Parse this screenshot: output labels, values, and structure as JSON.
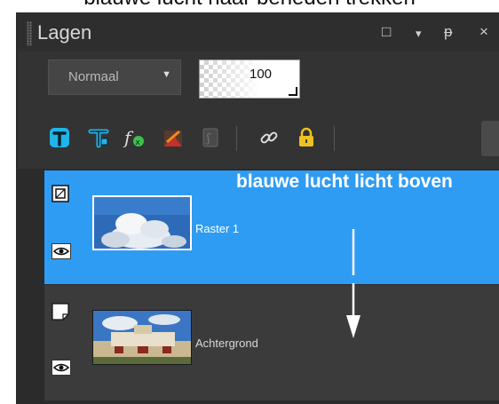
{
  "caption_top": "blauwe lucht naar beneden trekken",
  "panel": {
    "title": "Lagen",
    "controls": {
      "restore": "□",
      "menu": "▾",
      "pin": "ᵽ",
      "close": "×"
    }
  },
  "blend": {
    "mode": "Normaal"
  },
  "opacity": {
    "value": "100"
  },
  "toolbar": {
    "icons": [
      "new-raster-layer-icon",
      "new-vector-layer-icon",
      "layer-effects-icon",
      "layer-style-icon",
      "mask-icon",
      "link-icon",
      "lock-icon"
    ]
  },
  "annotation": {
    "text": "blauwe lucht licht boven"
  },
  "layers": [
    {
      "name": "Raster 1",
      "selected": true
    },
    {
      "name": "Achtergrond",
      "selected": false
    }
  ],
  "colors": {
    "panel_bg": "#3b3b3b",
    "selected_layer": "#2f9cf3",
    "icon_cyan": "#1fb5e8",
    "lock_yellow": "#f0c020",
    "fx_green": "#3cc24b"
  }
}
